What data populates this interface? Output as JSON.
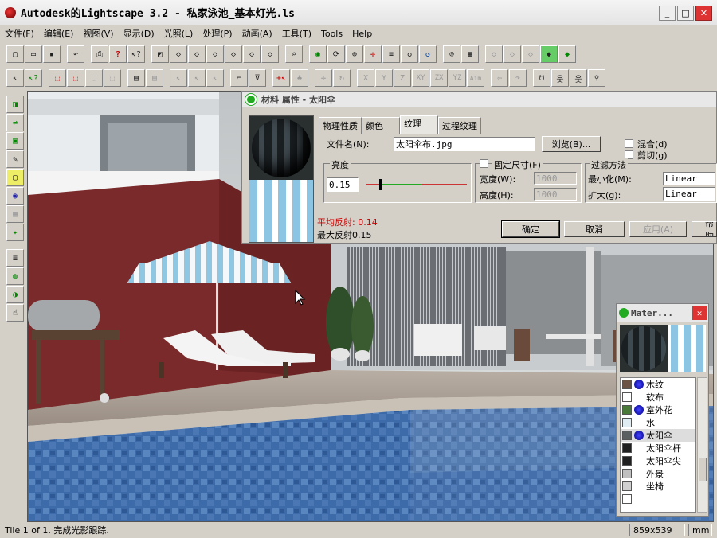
{
  "window": {
    "title": "Autodesk的Lightscape 3.2  - 私家泳池_基本灯光.ls",
    "min": "_",
    "max": "□",
    "close": "✕"
  },
  "menu": [
    "文件(F)",
    "编辑(E)",
    "视图(V)",
    "显示(D)",
    "光照(L)",
    "处理(P)",
    "动画(A)",
    "工具(T)",
    "Tools",
    "Help"
  ],
  "toolbar1_icons": [
    "new-icon",
    "open-icon",
    "save-icon",
    "",
    "undo-icon",
    "",
    "print-icon",
    "help-icon",
    "context-help-icon",
    "",
    "view-icon",
    "cube1-icon",
    "cube2-icon",
    "cube3-icon",
    "cube4-icon",
    "cube5-icon",
    "cube6-icon",
    "",
    "zoom-icon",
    "",
    "eye-icon",
    "walk-icon",
    "zoom-in-icon",
    "pan-icon",
    "level-icon",
    "rotate-icon",
    "orbit-icon",
    "",
    "magnify-icon",
    "fit-icon",
    "",
    "wire-icon",
    "hidden-icon",
    "shaded-icon",
    "solid-icon"
  ],
  "axis_buttons": [
    "X",
    "Y",
    "Z",
    "XY",
    "ZX",
    "YZ",
    "Aim"
  ],
  "material_dialog": {
    "title": "材料 属性 - 太阳伞",
    "tabs": [
      "物理性质",
      "颜色",
      "纹理",
      "过程纹理"
    ],
    "active_tab": "纹理",
    "filename_label": "文件名(N):",
    "filename_value": "太阳伞布.jpg",
    "browse": "浏览(B)...",
    "blend": "混合(d)",
    "clip": "剪切(g)",
    "brightness_label": "亮度",
    "brightness_value": "0.15",
    "fixed_size": "固定尺寸(F)",
    "width_label": "宽度(W):",
    "width_value": "1000",
    "height_label": "高度(H):",
    "height_value": "1000",
    "filter_label": "过滤方法",
    "min_label": "最小化(M):",
    "min_value": "Linear",
    "mag_label": "扩大(g):",
    "mag_value": "Linear",
    "avg_reflect": "平均反射: 0.14",
    "max_reflect": "最大反射0.15",
    "ok": "确定",
    "cancel": "取消",
    "apply": "应用(A)",
    "help": "帮助"
  },
  "materials_panel": {
    "title": "Mater...",
    "items": [
      {
        "name": "木纹",
        "swatch": "#6b5242",
        "icon": true
      },
      {
        "name": "软布",
        "swatch": "#ffffff",
        "icon": false
      },
      {
        "name": "室外花",
        "swatch": "#4a7a3a",
        "icon": true
      },
      {
        "name": "水",
        "swatch": "#e0eef4",
        "icon": false
      },
      {
        "name": "太阳伞",
        "swatch": "#5a6060",
        "icon": true,
        "selected": true
      },
      {
        "name": "太阳伞杆",
        "swatch": "#202020",
        "icon": false
      },
      {
        "name": "太阳伞尖",
        "swatch": "#202020",
        "icon": false
      },
      {
        "name": "外景",
        "swatch": "#c0c0c0",
        "icon": false
      },
      {
        "name": "坐椅",
        "swatch": "#d0d0d0",
        "icon": false
      }
    ]
  },
  "status": {
    "text": "Tile 1 of 1. 完成光影跟踪.",
    "size": "859x539",
    "unit": "mm"
  }
}
